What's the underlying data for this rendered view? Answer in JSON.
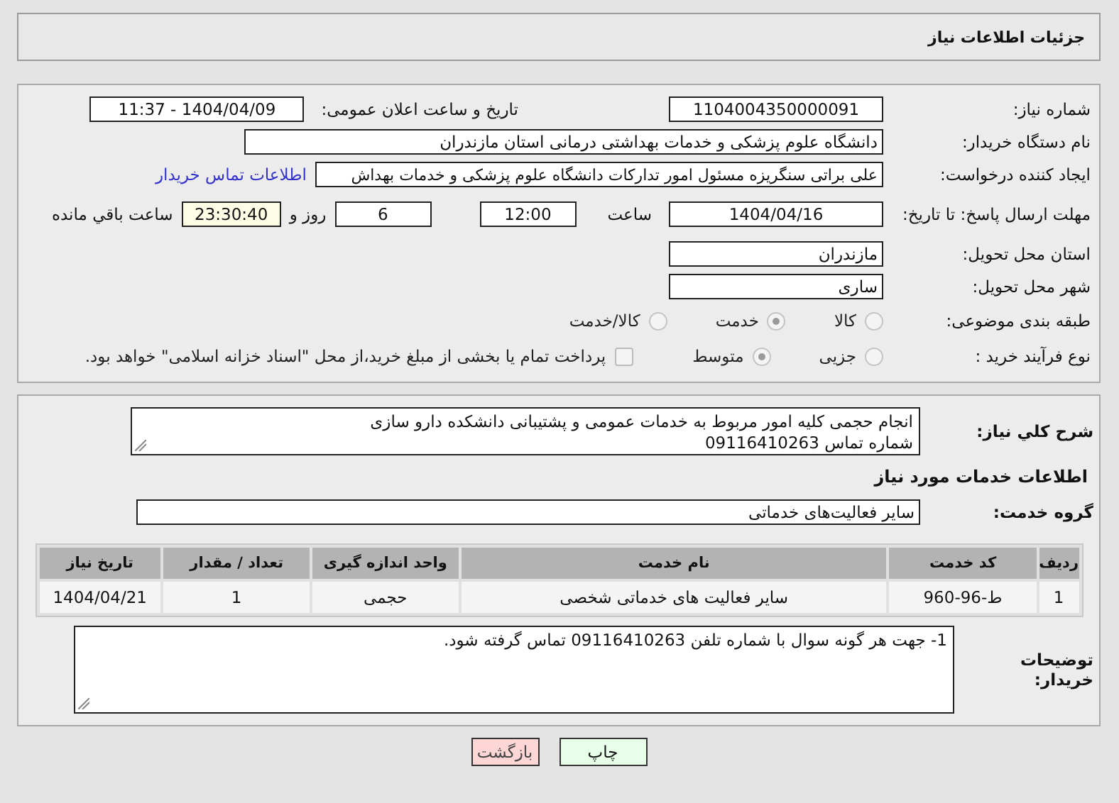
{
  "header": {
    "title": "جزئیات اطلاعات نیاز"
  },
  "details": {
    "need_number": {
      "label": "شماره نیاز:",
      "value": "1104004350000091"
    },
    "announce": {
      "label": "تاریخ و ساعت اعلان عمومی:",
      "value": "1404/04/09 - 11:37"
    },
    "buyer": {
      "label": "نام دستگاه خریدار:",
      "value": "دانشگاه علوم پزشکی و خدمات بهداشتی  درمانی استان مازندران"
    },
    "creator": {
      "label": "ایجاد کننده درخواست:",
      "value": "علی براتی سنگریزه مسئول امور تدارکات دانشگاه علوم پزشکی و خدمات بهداش",
      "link": "اطلاعات تماس خریدار"
    },
    "deadline": {
      "label": "مهلت ارسال پاسخ: تا تاریخ:",
      "date": "1404/04/16",
      "time_label": "ساعت",
      "time": "12:00",
      "days": "6",
      "days_label": "روز و",
      "remaining": "23:30:40",
      "remaining_label": "ساعت باقي مانده"
    },
    "province": {
      "label": "استان محل تحویل:",
      "value": "مازندران"
    },
    "city": {
      "label": "شهر محل تحویل:",
      "value": "ساری"
    },
    "category": {
      "label": "طبقه بندی موضوعی:",
      "options": [
        {
          "label": "کالا",
          "selected": false
        },
        {
          "label": "خدمت",
          "selected": true
        },
        {
          "label": "کالا/خدمت",
          "selected": false
        }
      ]
    },
    "process": {
      "label": "نوع فرآیند خرید :",
      "options": [
        {
          "label": "جزیی",
          "selected": false
        },
        {
          "label": "متوسط",
          "selected": true
        }
      ],
      "treasury": {
        "label": "پرداخت تمام یا بخشی از مبلغ خرید،از محل \"اسناد خزانه اسلامی\" خواهد بود.",
        "checked": false
      }
    }
  },
  "needs": {
    "description": {
      "label": "شرح کلي نياز:",
      "lines": [
        "انجام حجمی کلیه امور مربوط به خدمات عمومی و پشتیبانی دانشکده دارو سازی",
        "شماره تماس 09116410263"
      ]
    },
    "section_title": "اطلاعات خدمات مورد نیاز",
    "service_group": {
      "label": "گروه خدمت:",
      "value": "سایر فعالیت‌های خدماتی"
    },
    "table": {
      "columns": [
        "ردیف",
        "کد خدمت",
        "نام خدمت",
        "واحد اندازه گیری",
        "تعداد / مقدار",
        "تاریخ نیاز"
      ],
      "rows": [
        [
          "1",
          "ط-96-960",
          "سایر فعالیت های خدماتی شخصی",
          "حجمی",
          "1",
          "1404/04/21"
        ]
      ]
    },
    "buyer_notes": {
      "label": "توضیحات خریدار:",
      "value": "1-  جهت هر گونه سوال با شماره تلفن 09116410263 تماس گرفته شود."
    }
  },
  "buttons": [
    {
      "label": "چاپ",
      "kind": "print"
    },
    {
      "label": "بازگشت",
      "kind": "back"
    }
  ]
}
